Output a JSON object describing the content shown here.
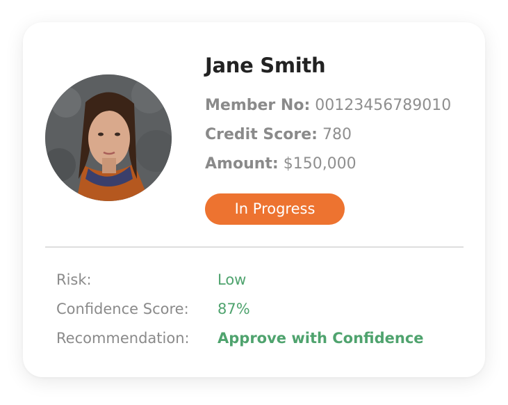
{
  "profile": {
    "name": "Jane Smith",
    "member_no_label": "Member No:",
    "member_no": "00123456789010",
    "credit_score_label": "Credit Score:",
    "credit_score": "780",
    "amount_label": "Amount:",
    "amount": "$150,000",
    "status": "In Progress"
  },
  "assessment": {
    "risk_label": "Risk:",
    "risk": "Low",
    "confidence_label": "Confidence Score:",
    "confidence": "87%",
    "recommendation_label": "Recommendation:",
    "recommendation": "Approve with Confidence"
  },
  "colors": {
    "status_badge": "#ed7330",
    "positive_value": "#4fa36e",
    "label_gray": "#8a8a8a",
    "name_text": "#222222"
  },
  "icons": {
    "avatar": "user-photo"
  }
}
